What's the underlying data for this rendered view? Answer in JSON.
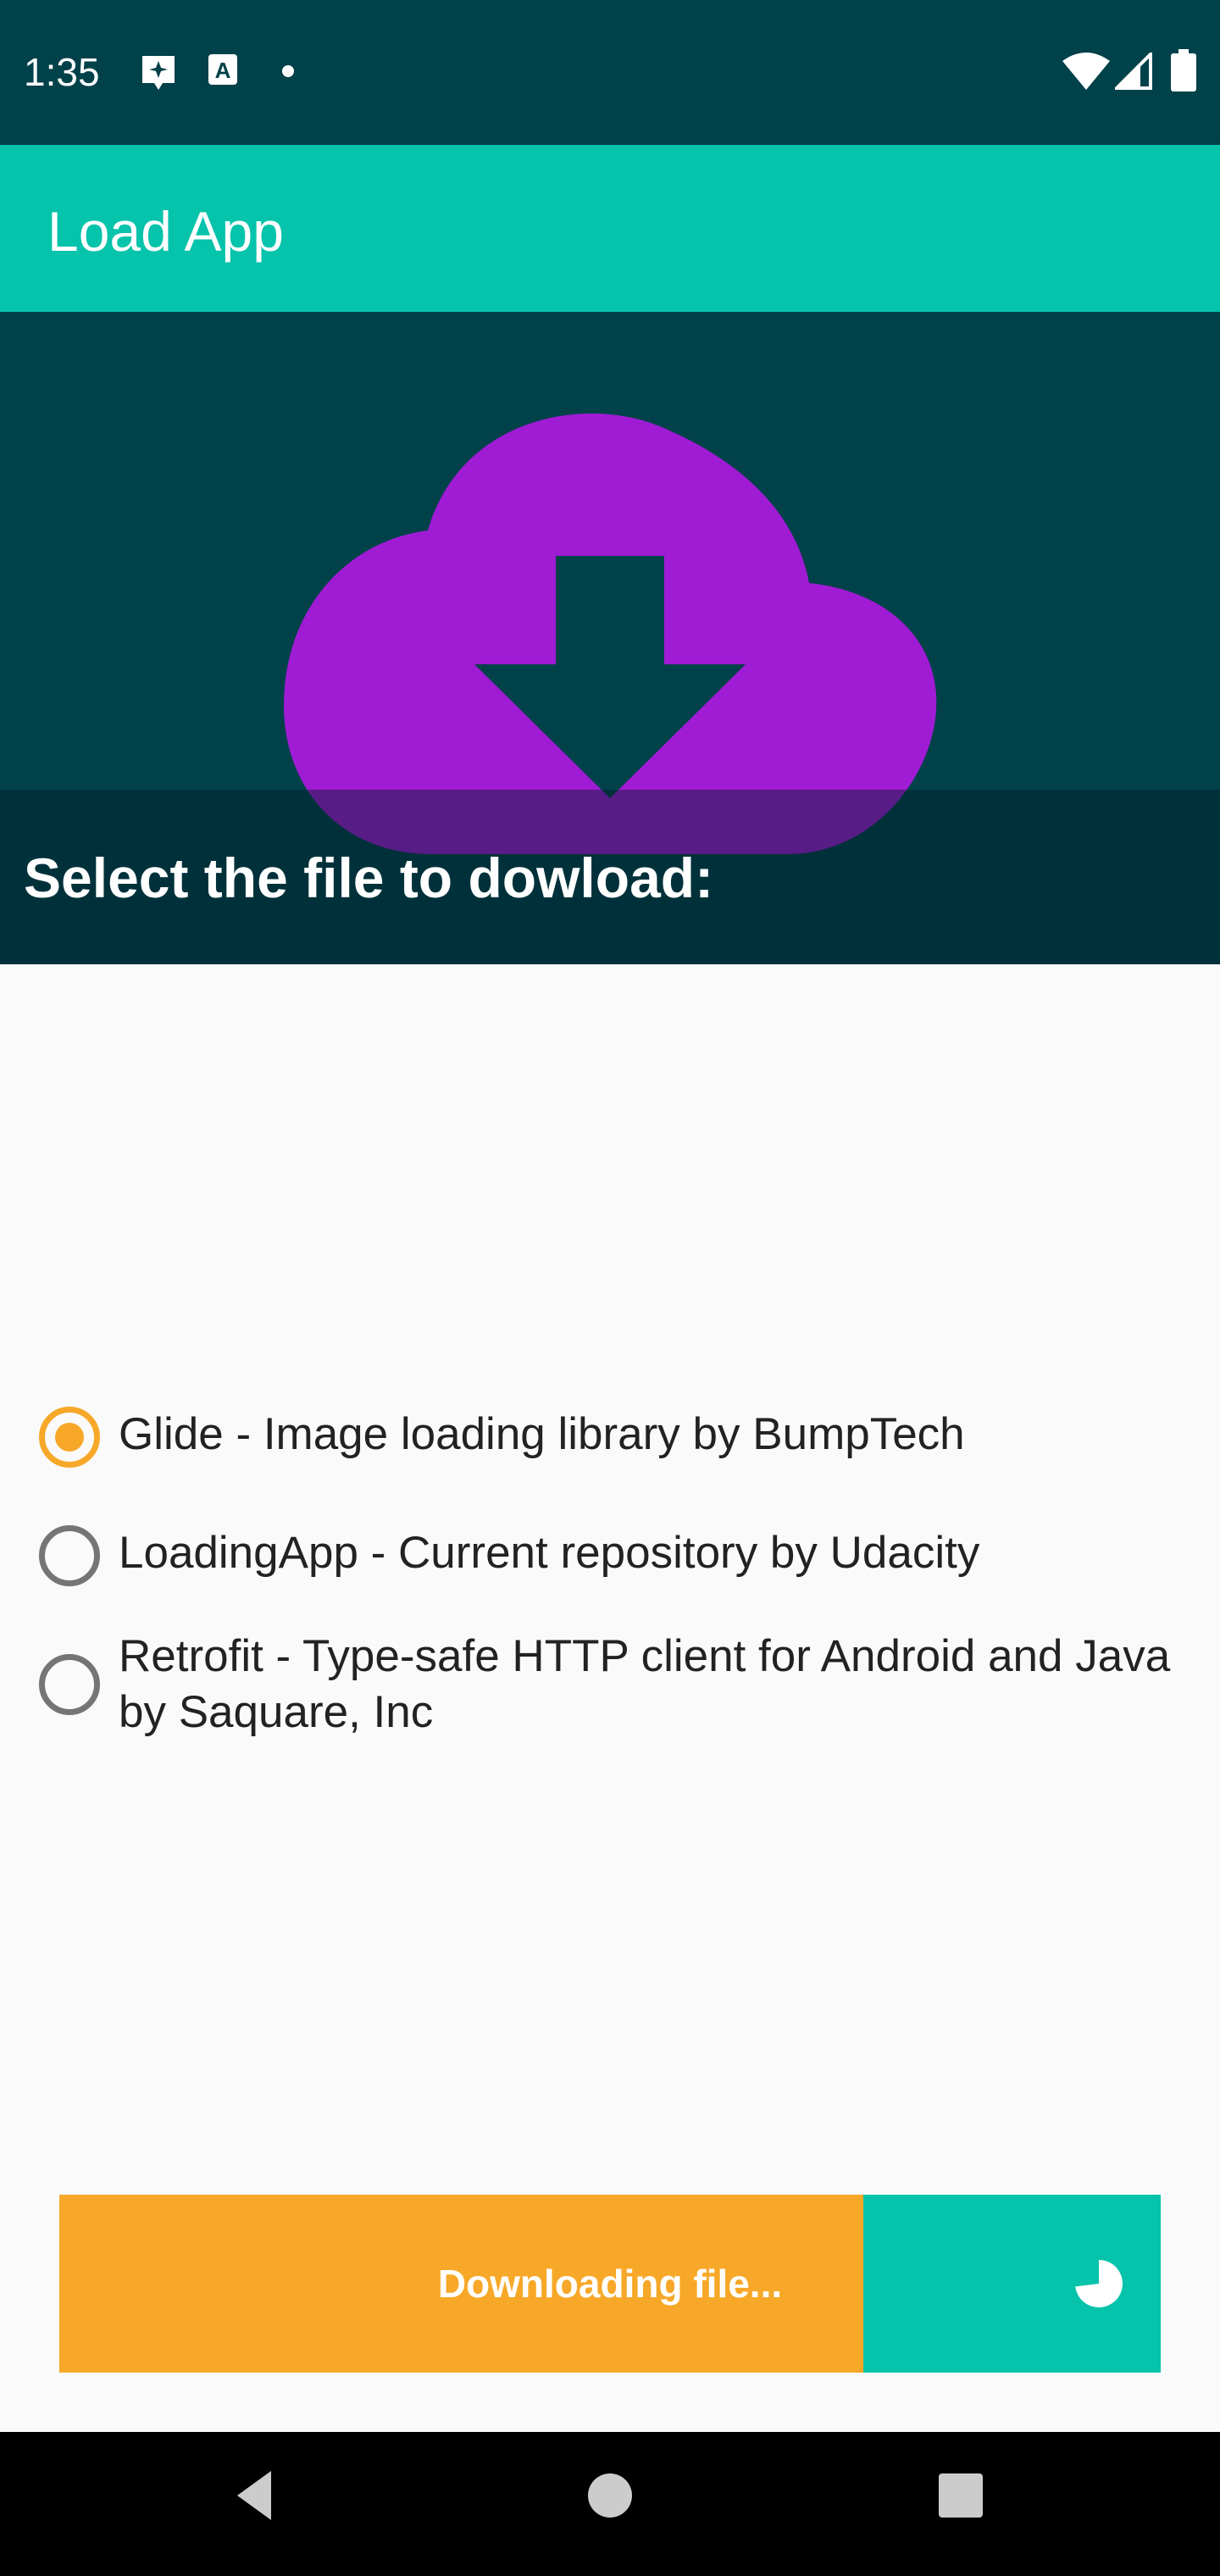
{
  "status_bar": {
    "time": "1:35",
    "icons": [
      "assistant-icon",
      "text-a-icon",
      "dot-icon",
      "wifi-icon",
      "signal-icon",
      "battery-icon"
    ]
  },
  "app_bar": {
    "title": "Load App"
  },
  "header": {
    "icon": "cloud-download-icon",
    "caption": "Select the file to dowload:",
    "cloud_color": "#a01bd4",
    "background_color": "#00414a"
  },
  "radio_options": [
    {
      "label": "Glide - Image loading library by BumpTech",
      "checked": true
    },
    {
      "label": "LoadingApp - Current repository by Udacity",
      "checked": false
    },
    {
      "label": "Retrofit - Type-safe HTTP client for Android and Java by Saquare, Inc",
      "checked": false
    }
  ],
  "download_button": {
    "label": "Downloading file...",
    "progress": 0.73,
    "progress_color": "#f7a828",
    "background_color": "#06c3ab"
  },
  "nav_bar": {
    "buttons": [
      "back-icon",
      "home-icon",
      "recents-icon"
    ]
  },
  "colors": {
    "primary_dark": "#00414a",
    "primary": "#06c3ab",
    "accent": "#f7a828"
  }
}
